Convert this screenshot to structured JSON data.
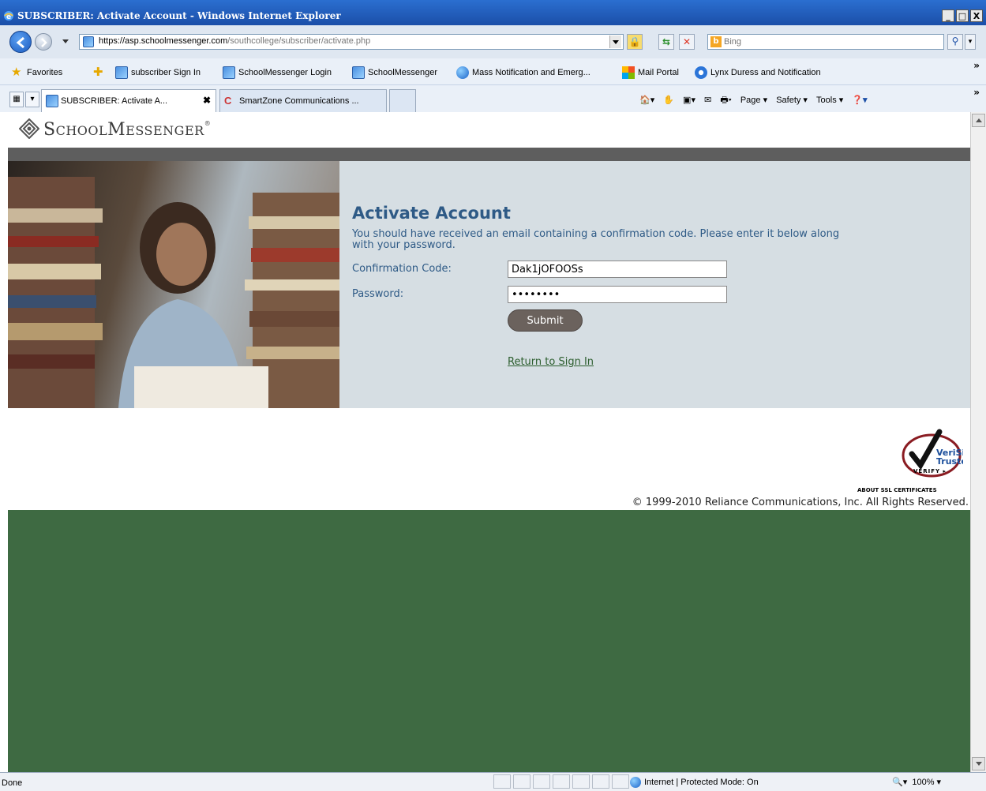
{
  "window": {
    "title": "SUBSCRIBER: Activate Account - Windows Internet Explorer",
    "controls": [
      "_",
      "□",
      "X"
    ]
  },
  "address": {
    "url_host": "https://asp.schoolmessenger.com",
    "url_path": "/southcollege/subscriber/activate.php",
    "search_placeholder": "Bing"
  },
  "favorites": {
    "label": "Favorites",
    "items": [
      "subscriber Sign In",
      "SchoolMessenger Login",
      "SchoolMessenger",
      "Mass Notification and Emerg...",
      "Mail Portal",
      "Lynx Duress and Notification"
    ]
  },
  "tabs": [
    {
      "label": "SUBSCRIBER: Activate A...",
      "active": true
    },
    {
      "label": "SmartZone Communications ...",
      "active": false
    }
  ],
  "toolbar": {
    "page": "Page ▾",
    "safety": "Safety ▾",
    "tools": "Tools ▾"
  },
  "page": {
    "brand_first": "S",
    "brand_rest": "CHOOL",
    "brand_first2": "M",
    "brand_rest2": "ESSENGER",
    "brand_reg": "®",
    "heading": "Activate Account",
    "description": "You should have received an email containing a confirmation code. Please enter it below along with your password.",
    "confirmation_label": "Confirmation Code:",
    "confirmation_value": "Dak1jOFOOSs",
    "password_label": "Password:",
    "password_value": "password",
    "submit_label": "Submit",
    "return_link": "Return to Sign In",
    "seal_line1": "VeriSign",
    "seal_line2": "Trusted",
    "seal_verify": "VERIFY ▸",
    "about_ssl": "ABOUT SSL CERTIFICATES",
    "copyright": "© 1999-2010 Reliance Communications, Inc. All Rights Reserved."
  },
  "status": {
    "text": "Done",
    "zone": "Internet | Protected Mode: On",
    "zoom": "100%"
  },
  "colors": {
    "heading": "#2e5a86",
    "page_background": "#3e6a42",
    "form_panel": "#d6dee3",
    "submit_button": "#6b625d"
  }
}
